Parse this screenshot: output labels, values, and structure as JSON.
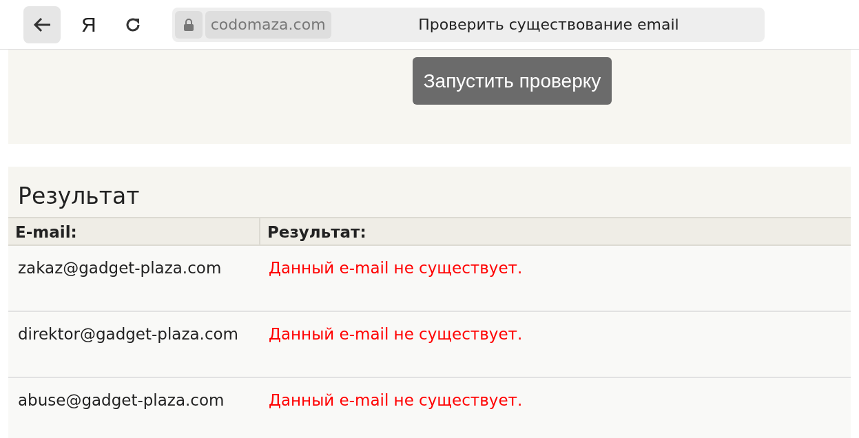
{
  "browser": {
    "logo": "Я",
    "url": "codomaza.com",
    "page_title": "Проверить существование email"
  },
  "form": {
    "button": "Запустить проверку"
  },
  "results": {
    "title": "Результат",
    "columns": [
      "E-mail:",
      "Результат:"
    ],
    "rows": [
      {
        "email": "zakaz@gadget-plaza.com",
        "result": "Данный e-mail не существует."
      },
      {
        "email": "direktor@gadget-plaza.com",
        "result": "Данный e-mail не существует."
      },
      {
        "email": "abuse@gadget-plaza.com",
        "result": "Данный e-mail не существует."
      }
    ]
  }
}
